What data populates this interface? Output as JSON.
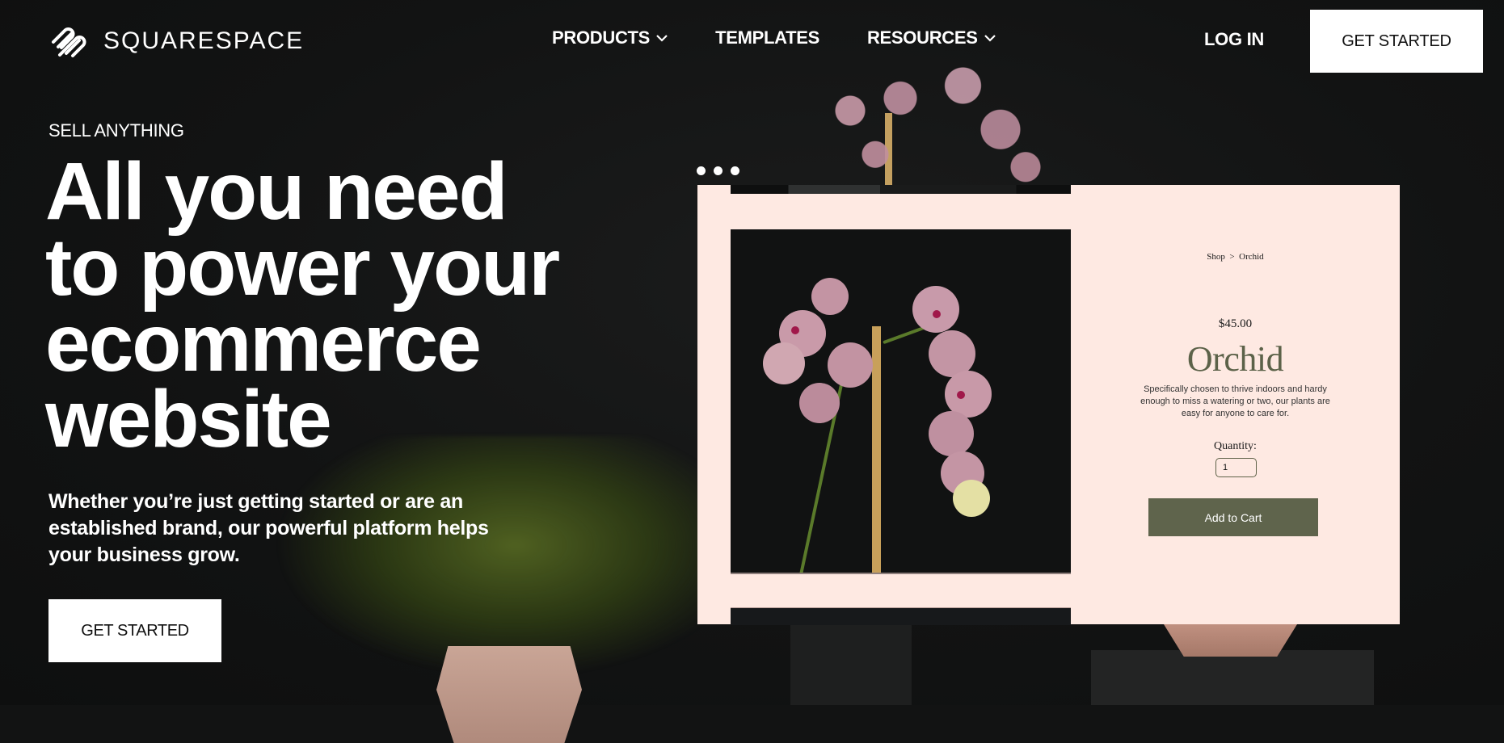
{
  "brand": {
    "name": "SQUARESPACE",
    "logo_icon": "squarespace-logo-icon"
  },
  "nav": {
    "items": [
      {
        "label": "PRODUCTS",
        "has_dropdown": true
      },
      {
        "label": "TEMPLATES",
        "has_dropdown": false
      },
      {
        "label": "RESOURCES",
        "has_dropdown": true
      }
    ],
    "login_label": "LOG IN",
    "cta_label": "GET STARTED"
  },
  "hero": {
    "eyebrow": "SELL ANYTHING",
    "headline_lines": [
      "All you need",
      "to power your",
      "ecommerce",
      "website"
    ],
    "subhead": "Whether you’re just getting started or are an established brand, our powerful platform helps your business grow.",
    "cta_label": "GET STARTED"
  },
  "mock_product": {
    "breadcrumb": {
      "parent": "Shop",
      "separator": ">",
      "current": "Orchid"
    },
    "price": "$45.00",
    "title": "Orchid",
    "description": "Specifically chosen to thrive indoors and hardy enough to miss a watering or two, our plants are easy for anyone to care for.",
    "quantity_label": "Quantity:",
    "quantity_value": "1",
    "add_to_cart_label": "Add to Cart"
  },
  "colors": {
    "background": "#121313",
    "card": "#fee9e2",
    "accent_olive": "#5f644c",
    "title_olive": "#5c6249",
    "button_bg": "#ffffff"
  }
}
